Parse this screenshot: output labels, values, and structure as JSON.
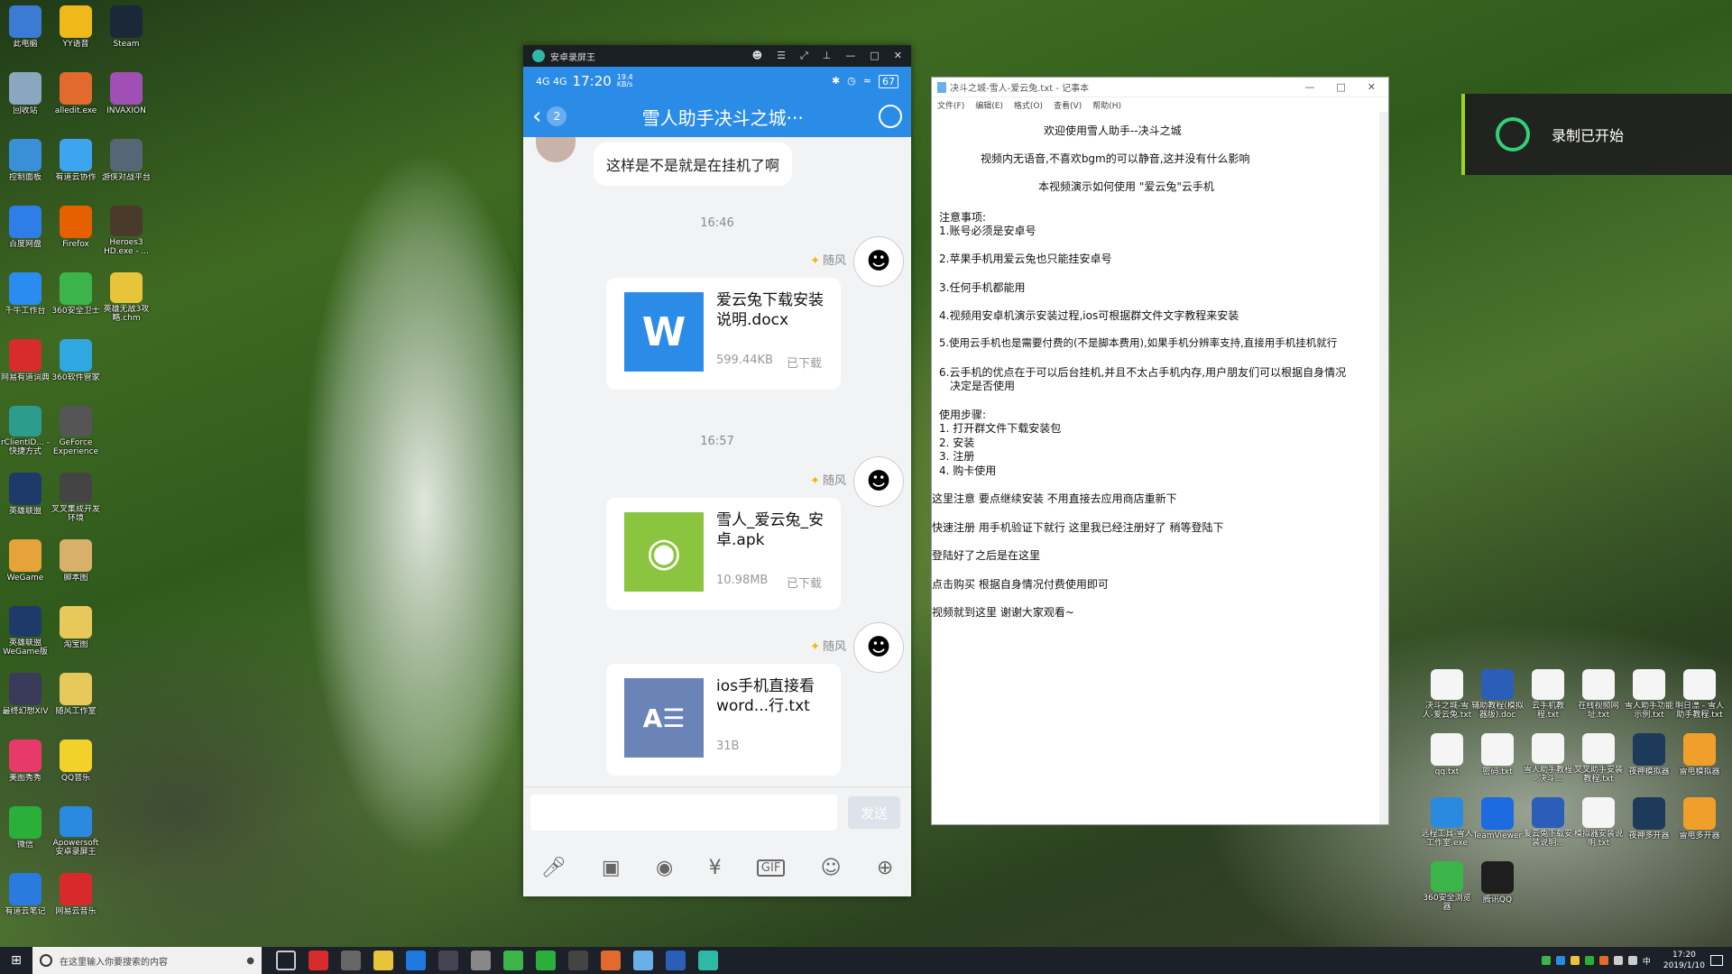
{
  "desktop_left": [
    {
      "label": "此电脑",
      "color": "#3b7bd4"
    },
    {
      "label": "YY语音",
      "color": "#f1b81a"
    },
    {
      "label": "Steam",
      "color": "#1b2838"
    },
    {
      "label": "回收站",
      "color": "#8aa6c1"
    },
    {
      "label": "alledit.exe",
      "color": "#e26a2c"
    },
    {
      "label": "INVAXION",
      "color": "#a04fb5"
    },
    {
      "label": "控制面板",
      "color": "#3a8fd9"
    },
    {
      "label": "有道云协作",
      "color": "#3da4ef"
    },
    {
      "label": "游侠对战平台",
      "color": "#556677"
    },
    {
      "label": "百度网盘",
      "color": "#2f7ee8"
    },
    {
      "label": "Firefox",
      "color": "#e66000"
    },
    {
      "label": "Heroes3 HD.exe - ...",
      "color": "#4a3a2a"
    },
    {
      "label": "千牛工作台",
      "color": "#2a8cf0"
    },
    {
      "label": "360安全卫士",
      "color": "#3bb54a"
    },
    {
      "label": "英雄无敌3攻略.chm",
      "color": "#e8c43a"
    },
    {
      "label": "网易有道词典",
      "color": "#d82b2b"
    },
    {
      "label": "360软件管家",
      "color": "#2fa7e0"
    },
    {
      "label": "",
      "color": "transparent"
    },
    {
      "label": "rClientID... - 快捷方式",
      "color": "#2c9c8e"
    },
    {
      "label": "GeForce Experience",
      "color": "#555555"
    },
    {
      "label": "",
      "color": "transparent"
    },
    {
      "label": "英雄联盟",
      "color": "#1e3a6a"
    },
    {
      "label": "叉叉集成开发环境",
      "color": "#444444"
    },
    {
      "label": "",
      "color": "transparent"
    },
    {
      "label": "WeGame",
      "color": "#e8a23a"
    },
    {
      "label": "脚本图",
      "color": "#d8b06a"
    },
    {
      "label": "",
      "color": "transparent"
    },
    {
      "label": "英雄联盟WeGame版",
      "color": "#1e3a6a"
    },
    {
      "label": "淘宝图",
      "color": "#e8c85a"
    },
    {
      "label": "",
      "color": "transparent"
    },
    {
      "label": "最终幻想XIV",
      "color": "#3a3a5a"
    },
    {
      "label": "随风工作室",
      "color": "#e8c85a"
    },
    {
      "label": "",
      "color": "transparent"
    },
    {
      "label": "美图秀秀",
      "color": "#e83a6a"
    },
    {
      "label": "QQ音乐",
      "color": "#f2d22a"
    },
    {
      "label": "",
      "color": "transparent"
    },
    {
      "label": "微信",
      "color": "#2ab03a"
    },
    {
      "label": "Apowersoft安卓录屏王",
      "color": "#2a8ae0"
    },
    {
      "label": "",
      "color": "transparent"
    },
    {
      "label": "有道云笔记",
      "color": "#2a7ae0"
    },
    {
      "label": "网易云音乐",
      "color": "#d82a2a"
    }
  ],
  "desktop_right": [
    {
      "label": "决斗之城-雪人-爱云兔.txt",
      "color": "#f5f5f5"
    },
    {
      "label": "辅助教程(模拟器版).doc",
      "color": "#2b5eb8"
    },
    {
      "label": "云手机教程.txt",
      "color": "#f5f5f5"
    },
    {
      "label": "在线视频网址.txt",
      "color": "#f5f5f5"
    },
    {
      "label": "雪人助手功能示例.txt",
      "color": "#f5f5f5"
    },
    {
      "label": "明日漂 - 雪人助手教程.txt",
      "color": "#f5f5f5"
    },
    {
      "label": "qq.txt",
      "color": "#f5f5f5"
    },
    {
      "label": "密码.txt",
      "color": "#f5f5f5"
    },
    {
      "label": "雪人助手教程 - 决斗...",
      "color": "#f5f5f5"
    },
    {
      "label": "叉叉助手安装教程.txt",
      "color": "#f5f5f5"
    },
    {
      "label": "夜神模拟器",
      "color": "#1e3a5a"
    },
    {
      "label": "雷电模拟器",
      "color": "#f0a02a"
    },
    {
      "label": "远程工具-雪人工作室.exe",
      "color": "#2a8ae0"
    },
    {
      "label": "TeamViewer",
      "color": "#1e6ae0"
    },
    {
      "label": "爱云兔下载安装说明...",
      "color": "#2b5eb8"
    },
    {
      "label": "模拟器安装说明.txt",
      "color": "#f5f5f5"
    },
    {
      "label": "夜神多开器",
      "color": "#1e3a5a"
    },
    {
      "label": "雷电多开器",
      "color": "#f0a02a"
    },
    {
      "label": "360安全浏览器",
      "color": "#3bb54a"
    },
    {
      "label": "腾讯QQ",
      "color": "#1e1e1e"
    }
  ],
  "phone_window": {
    "app_title": "安卓录屏王",
    "status_time": "17:20",
    "status_signal": "4G 4G",
    "status_speed": "19.4 KB/s",
    "status_battery": "67",
    "badge_count": "2",
    "chat_title": "雪人助手决斗之城···",
    "first_message": "这样是不是就是在挂机了啊",
    "time1": "16:46",
    "time2": "16:57",
    "sender_name": "随风",
    "files": [
      {
        "name": "爱云兔下载安装说明.docx",
        "size": "599.44KB",
        "status": "已下载",
        "icon": "W",
        "color": "#2b8ce8"
      },
      {
        "name": "雪人_爱云兔_安卓.apk",
        "size": "10.98MB",
        "status": "已下载",
        "icon": "◉",
        "color": "#8bc53f"
      },
      {
        "name": "ios手机直接看word...行.txt",
        "size": "31B",
        "status": "",
        "icon": "A☰",
        "color": "#6a84b8"
      }
    ],
    "send_label": "发送",
    "toolbar_icons": [
      "microphone-icon",
      "image-icon",
      "camera-icon",
      "red-packet-icon",
      "gif-icon",
      "emoji-icon",
      "plus-icon"
    ]
  },
  "notepad": {
    "title": "决斗之城-雪人-爱云兔.txt - 记事本",
    "menu": [
      "文件(F)",
      "编辑(E)",
      "格式(O)",
      "查看(V)",
      "帮助(H)"
    ],
    "lines": [
      "欢迎使用雪人助手--决斗之城",
      "视频内无语音,不喜欢bgm的可以静音,这并没有什么影响",
      "本视频演示如何使用 \"爱云兔\"云手机",
      "注意事项:",
      "1.账号必须是安卓号",
      "2.苹果手机用爱云兔也只能挂安卓号",
      "3.任何手机都能用",
      "4.视频用安卓机演示安装过程,ios可根据群文件文字教程来安装",
      "5.使用云手机也是需要付费的(不是脚本费用),如果手机分辨率支持,直接用手机挂机就行",
      "6.云手机的优点在于可以后台挂机,并且不太占手机内存,用户朋友们可以根据自身情况",
      "决定是否使用",
      "使用步骤:",
      "1. 打开群文件下载安装包",
      "2. 安装",
      "3. 注册",
      "4. 购卡使用",
      "这里注意 要点继续安装  不用直接去应用商店重新下",
      "快速注册 用手机验证下就行  这里我已经注册好了  稍等登陆下",
      "登陆好了之后是在这里",
      "点击购买    根据自身情况付费使用即可",
      "视频就到这里  谢谢大家观看~"
    ]
  },
  "recording_toast": "录制已开始",
  "taskbar": {
    "search_placeholder": "在这里输入你要搜索的内容",
    "clock_time": "17:20",
    "clock_date": "2019/1/10",
    "ime": "中"
  }
}
